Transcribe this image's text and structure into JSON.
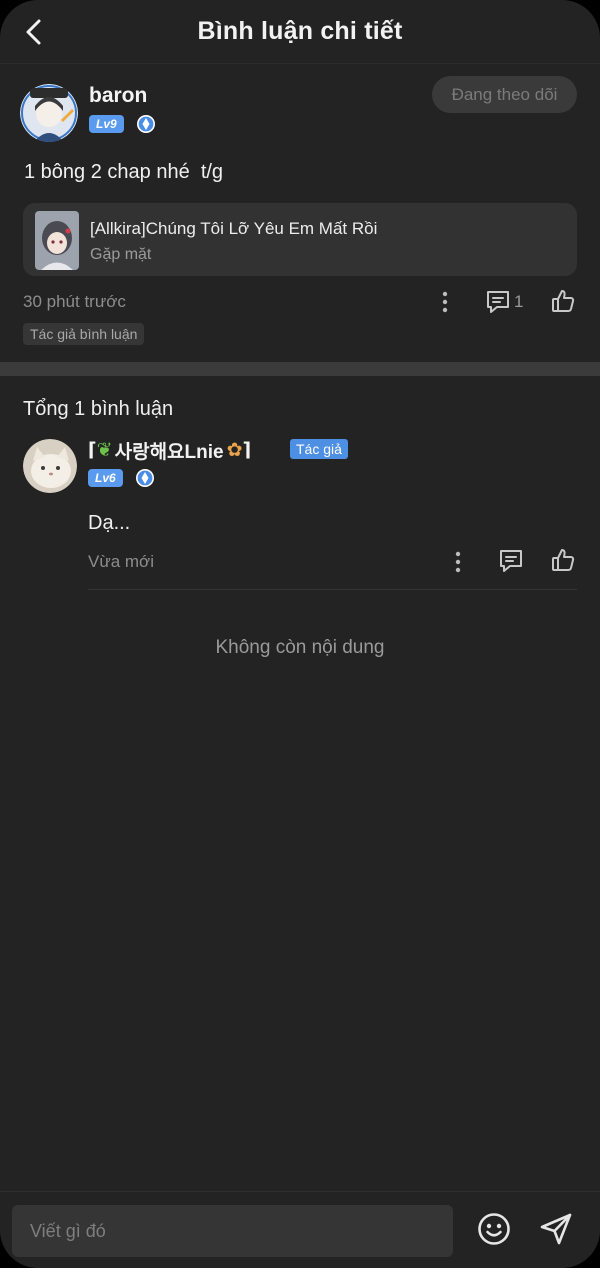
{
  "header": {
    "title": "Bình luận chi tiết"
  },
  "post": {
    "username": "baron",
    "level": "Lv9",
    "follow_label": "Đang theo dõi",
    "text": "1 bông 2 chap nhé  t/g",
    "manga": {
      "title": "[Allkira]Chúng Tôi Lỡ Yêu Em Mất Rồi",
      "chapter": "Gặp mặt"
    },
    "time": "30 phút trước",
    "reply_count": "1",
    "author_tag": "Tác giả bình luận"
  },
  "comments": {
    "total": "Tổng 1 bình luận",
    "items": [
      {
        "username": "사랑해요Lnie",
        "level": "Lv6",
        "author_badge": "Tác giả",
        "text": "Dạ...",
        "time": "Vừa mới"
      }
    ],
    "end_note": "Không còn nội dung"
  },
  "composer": {
    "placeholder": "Viết gì đó"
  },
  "colors": {
    "background": "#232323",
    "level_badge": "#5a9bf0",
    "author_badge": "#4d8fe3"
  }
}
